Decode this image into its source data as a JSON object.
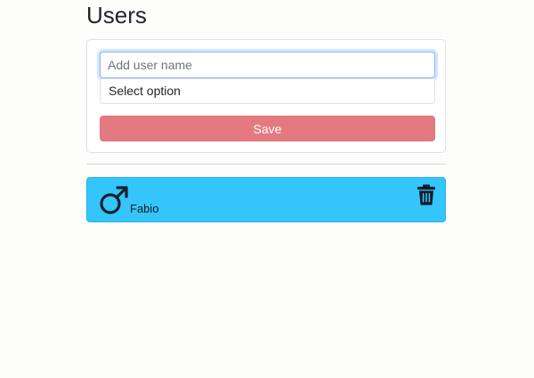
{
  "header": {
    "title": "Users"
  },
  "form": {
    "name_placeholder": "Add user name",
    "select_value": "Select option",
    "save_label": "Save"
  },
  "users": [
    {
      "name": "Fabio",
      "gender_icon": "male-icon",
      "delete_icon": "trash-icon"
    }
  ],
  "colors": {
    "save_button": "#e47a80",
    "user_card": "#33c5fc",
    "input_focus": "#86b7fe"
  }
}
